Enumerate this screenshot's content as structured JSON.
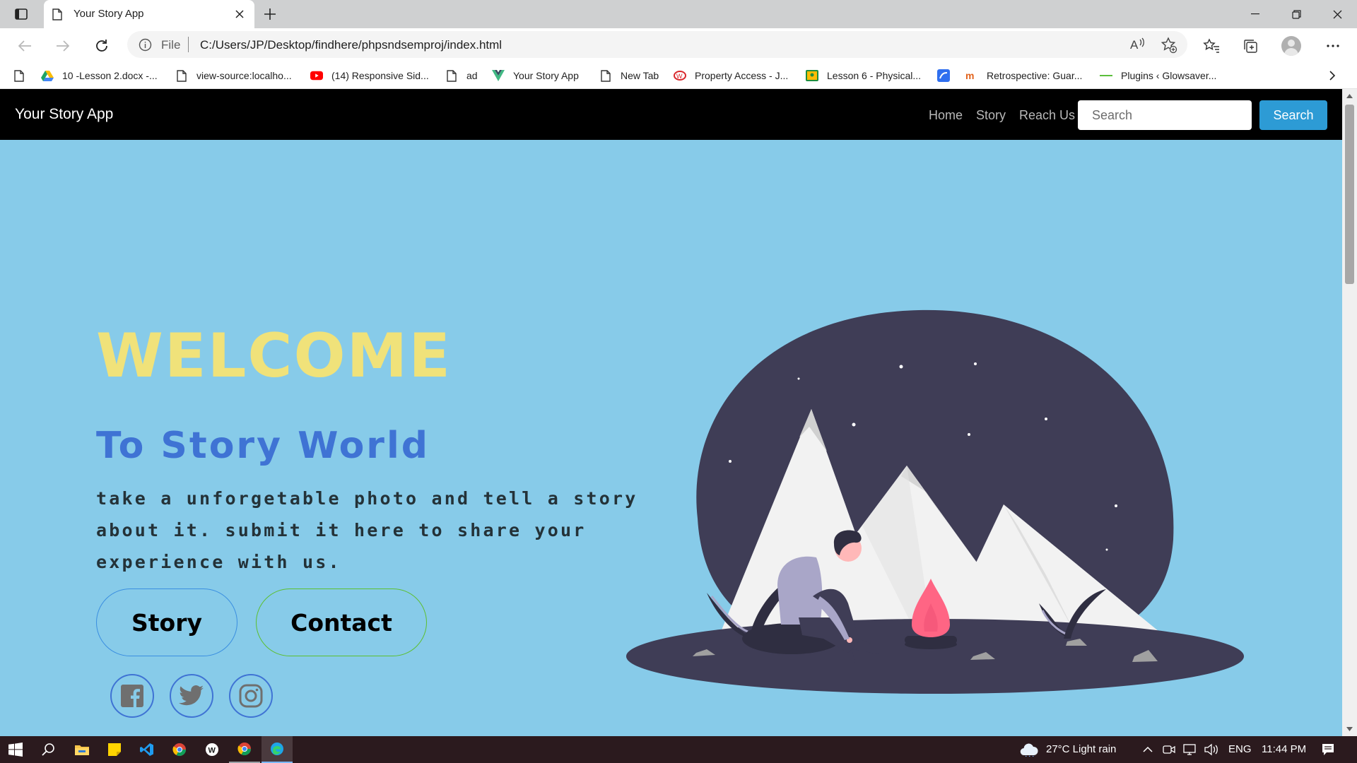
{
  "browser": {
    "tab_title": "Your Story App",
    "address_scheme": "File",
    "address_url": "C:/Users/JP/Desktop/findhere/phpsndsemproj/index.html",
    "bookmarks": [
      {
        "label": "10 -Lesson 2.docx -...",
        "icon": "google-drive-icon"
      },
      {
        "label": "view-source:localho...",
        "icon": "page-icon"
      },
      {
        "label": "(14) Responsive Sid...",
        "icon": "youtube-icon"
      },
      {
        "label": "ad",
        "icon": "page-icon"
      },
      {
        "label": "Your Story App",
        "icon": "vue-icon"
      },
      {
        "label": "New Tab",
        "icon": "page-icon"
      },
      {
        "label": "Property Access - J...",
        "icon": "property-icon"
      },
      {
        "label": "Lesson 6 - Physical...",
        "icon": "classroom-icon"
      },
      {
        "label": "",
        "icon": "app-icon"
      },
      {
        "label": "Retrospective: Guar...",
        "icon": "medium-icon"
      },
      {
        "label": "Plugins ‹ Glowsaver...",
        "icon": "dash-icon"
      }
    ]
  },
  "site": {
    "brand": "Your Story App",
    "nav": [
      "Home",
      "Story",
      "Reach Us"
    ],
    "search_placeholder": "Search",
    "search_button": "Search"
  },
  "hero": {
    "welcome": "WELCOME",
    "subtitle": "To Story World",
    "description": "take a unforgetable photo and tell a story about it. submit it here to share your experience with us.",
    "story_button": "Story",
    "contact_button": "Contact",
    "social": [
      "facebook-icon",
      "twitter-icon",
      "instagram-icon"
    ]
  },
  "taskbar": {
    "weather": "27°C  Light rain",
    "language": "ENG",
    "time": "11:44 PM"
  },
  "colors": {
    "hero_bg": "#87cbe9",
    "welcome": "#f0e27a",
    "subtitle": "#3f73d4",
    "search_button": "#2d9bd5",
    "nav_bg": "#000000"
  }
}
